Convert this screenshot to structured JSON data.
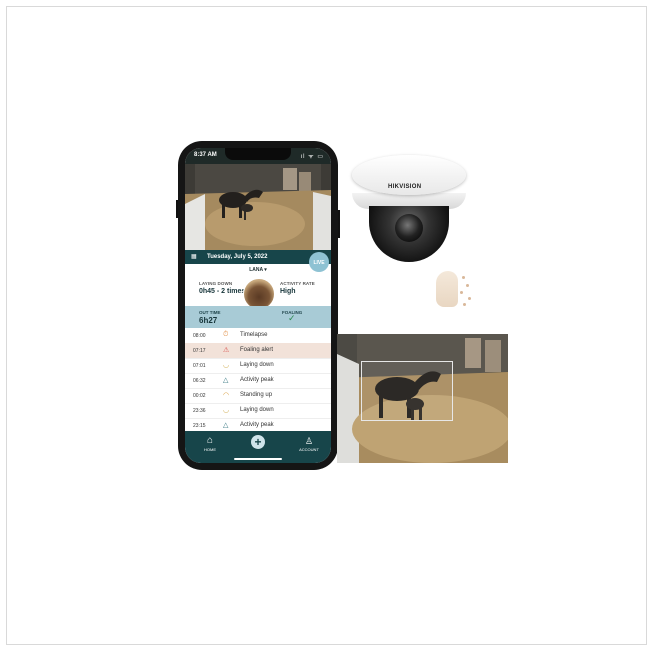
{
  "phone": {
    "status_time": "8:37 AM",
    "status_icons": "ıl ᯤ ▭",
    "date": "Tuesday, July 5, 2022",
    "live_label": "LIVE",
    "horse_name": "LANA ▾",
    "laying_down": {
      "label": "LAYING DOWN",
      "value": "0h45 - 2 times"
    },
    "activity_rate": {
      "label": "ACTIVITY RATE",
      "value": "High"
    },
    "out_time": {
      "label": "OUT TIME",
      "value": "6h27"
    },
    "foaling": {
      "label": "FOALING",
      "check": "✓"
    },
    "events": [
      {
        "time": "08:00",
        "icon": "⏱",
        "label": "Timelapse",
        "color": "#e49a58",
        "alert": false
      },
      {
        "time": "07:17",
        "icon": "⚠",
        "label": "Foaling alert",
        "color": "#d9534f",
        "alert": true
      },
      {
        "time": "07:01",
        "icon": "◡",
        "label": "Laying down",
        "color": "#caa33c",
        "alert": false
      },
      {
        "time": "06:32",
        "icon": "△",
        "label": "Activity peak",
        "color": "#2a6f7a",
        "alert": false
      },
      {
        "time": "00:02",
        "icon": "◠",
        "label": "Standing up",
        "color": "#d79a3a",
        "alert": false
      },
      {
        "time": "23:36",
        "icon": "◡",
        "label": "Laying down",
        "color": "#caa33c",
        "alert": false
      },
      {
        "time": "23:15",
        "icon": "△",
        "label": "Activity peak",
        "color": "#2a6f7a",
        "alert": false
      }
    ],
    "nav": {
      "home": "HOME",
      "home_icon": "⌂",
      "add": "+",
      "account": "ACCOUNT",
      "account_icon": "♙"
    }
  },
  "camera": {
    "brand": "HIKVISION"
  },
  "colors": {
    "teal": "#17454a",
    "light_blue": "#a8cbd6",
    "alert_bg": "#f2e2d9"
  }
}
